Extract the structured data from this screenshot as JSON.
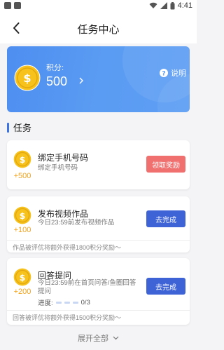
{
  "status_bar": {
    "time": "4:41"
  },
  "header": {
    "title": "任务中心"
  },
  "points_card": {
    "label": "积分:",
    "value": "500",
    "help_label": "说明"
  },
  "section": {
    "title": "任务"
  },
  "tasks": [
    {
      "title": "绑定手机号码",
      "desc": "绑定手机号码",
      "reward": "+500",
      "button": "领取奖励"
    },
    {
      "title": "发布视频作品",
      "desc": "今日23:59前发布视频作品",
      "reward": "+100",
      "button": "去完成",
      "footer": "作品被评优将额外获得1800积分奖励～"
    },
    {
      "title": "回答提问",
      "desc": "今日23:59前在首页问答/鱼圈回答提问",
      "reward": "+200",
      "button": "去完成",
      "progress_label": "进度:",
      "progress_value": "0/3",
      "footer": "回答被评优将额外获得1500积分奖励～"
    }
  ],
  "expand_label": "展开全部",
  "colors": {
    "accent_blue": "#3d63d6",
    "claim_red": "#f07070",
    "coin_gold": "#f6c21b",
    "reward_orange": "#f2a31a"
  }
}
